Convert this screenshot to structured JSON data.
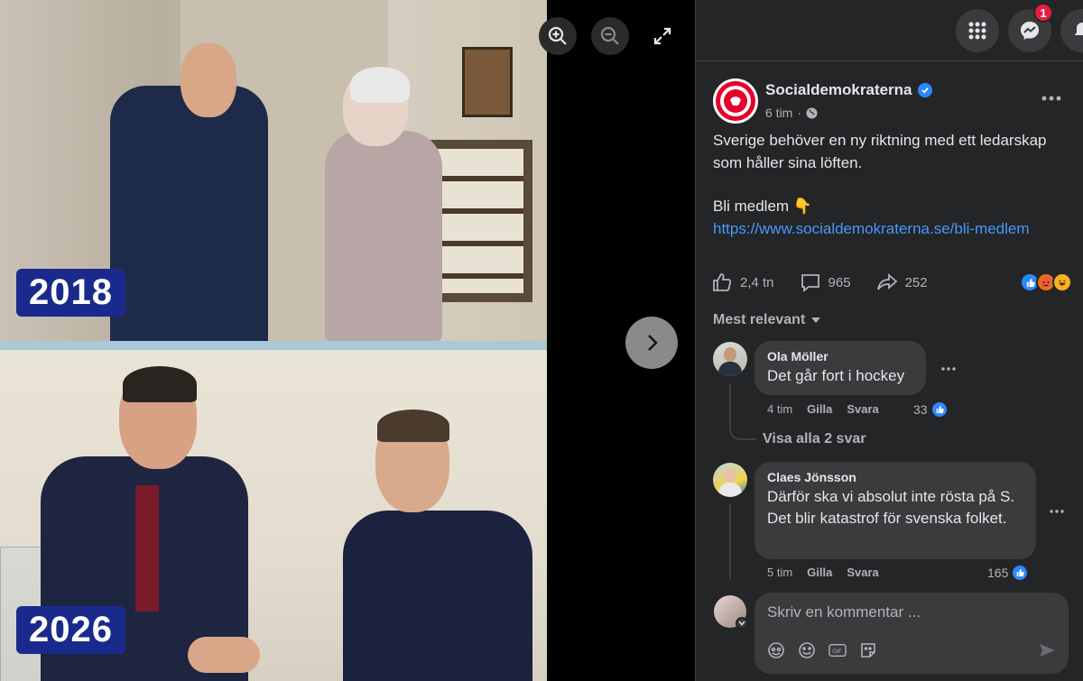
{
  "viewer": {
    "year_top": "2018",
    "year_bottom": "2026",
    "buttons": [
      "zoom-in-icon",
      "zoom-out-icon",
      "expand-icon",
      "next-arrow-icon"
    ]
  },
  "topbar": {
    "notification_count": "1"
  },
  "post": {
    "author": "Socialdemokraterna",
    "time": "6 tim",
    "text_line1": "Sverige behöver en ny riktning med ett ledarskap som håller sina löften.",
    "text_line2": "Bli medlem 👇",
    "link": "https://www.socialdemokraterna.se/bli-medlem",
    "reactions": "2,4 tn",
    "comments": "965",
    "shares": "252"
  },
  "comments": {
    "sort_label": "Mest relevant",
    "items": [
      {
        "author": "Ola Möller",
        "text": "Det går fort i hockey",
        "time": "4 tim",
        "like": "Gilla",
        "reply": "Svara",
        "count": "33"
      },
      {
        "author": "Claes Jönsson",
        "text": "Därför ska vi absolut inte rösta på S. Det blir katastrof för svenska folket.",
        "time": "5 tim",
        "like": "Gilla",
        "reply": "Svara",
        "count": "165"
      }
    ],
    "show_replies": "Visa alla 2 svar",
    "composer_placeholder": "Skriv en kommentar ..."
  },
  "colors": {
    "panel_bg": "#242526",
    "bubble_bg": "#3a3b3c",
    "link": "#4599ff",
    "badge_blue": "#1a2a8c",
    "notification_red": "#e41e3f"
  }
}
